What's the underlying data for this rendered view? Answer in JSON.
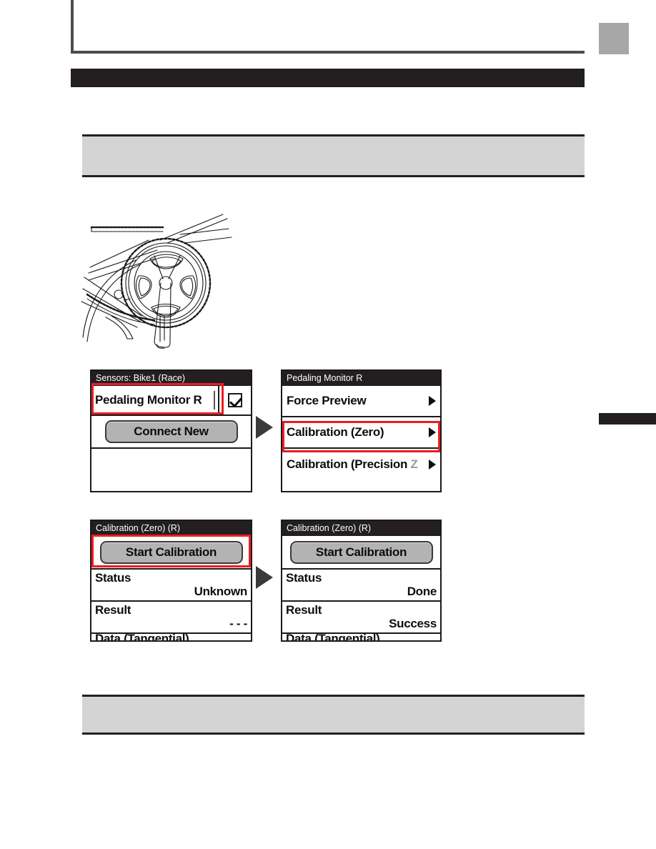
{
  "page": {
    "header_title": "",
    "section_bar_text": "",
    "callout_top_text": "",
    "callout_bottom_text": "",
    "tab_gray": "",
    "tab_black": ""
  },
  "illustration": {
    "name": "bicycle-crankset-line-art",
    "caption": ""
  },
  "flow": {
    "step_arrow_icon": "triangle-right-icon"
  },
  "screens": [
    {
      "id": "sensors",
      "title": "Sensors: Bike1 (Race)",
      "sensor_item": "Pedaling Monitor R",
      "sensor_checked": true,
      "connect_button": "Connect New"
    },
    {
      "id": "pedaling-monitor-r",
      "title": "Pedaling Monitor R",
      "menu": [
        {
          "label": "Force Preview",
          "arrow": "chevron-right-icon",
          "highlighted": false
        },
        {
          "label": "Calibration (Zero)",
          "arrow": "chevron-right-icon",
          "highlighted": true
        },
        {
          "label_main": "Calibration (Precision ",
          "label_dim": "Z",
          "arrow": "chevron-right-icon",
          "highlighted": false
        }
      ]
    },
    {
      "id": "calibration-zero-before",
      "title": "Calibration (Zero) (R)",
      "start_button": "Start Calibration",
      "rows": [
        {
          "key": "Status",
          "value": "Unknown"
        },
        {
          "key": "Result",
          "value": "- - -"
        }
      ],
      "clipped_row": "Data (Tangential)"
    },
    {
      "id": "calibration-zero-after",
      "title": "Calibration (Zero) (R)",
      "start_button": "Start Calibration",
      "rows": [
        {
          "key": "Status",
          "value": "Done"
        },
        {
          "key": "Result",
          "value": "Success"
        }
      ],
      "clipped_row": "Data (Tangential)"
    }
  ],
  "colors": {
    "highlight": "#ed1c24",
    "section_bar": "#231f20",
    "callout_fill": "#d4d4d4",
    "button_fill": "#b3b3b3",
    "tab_gray": "#a7a7a7"
  }
}
